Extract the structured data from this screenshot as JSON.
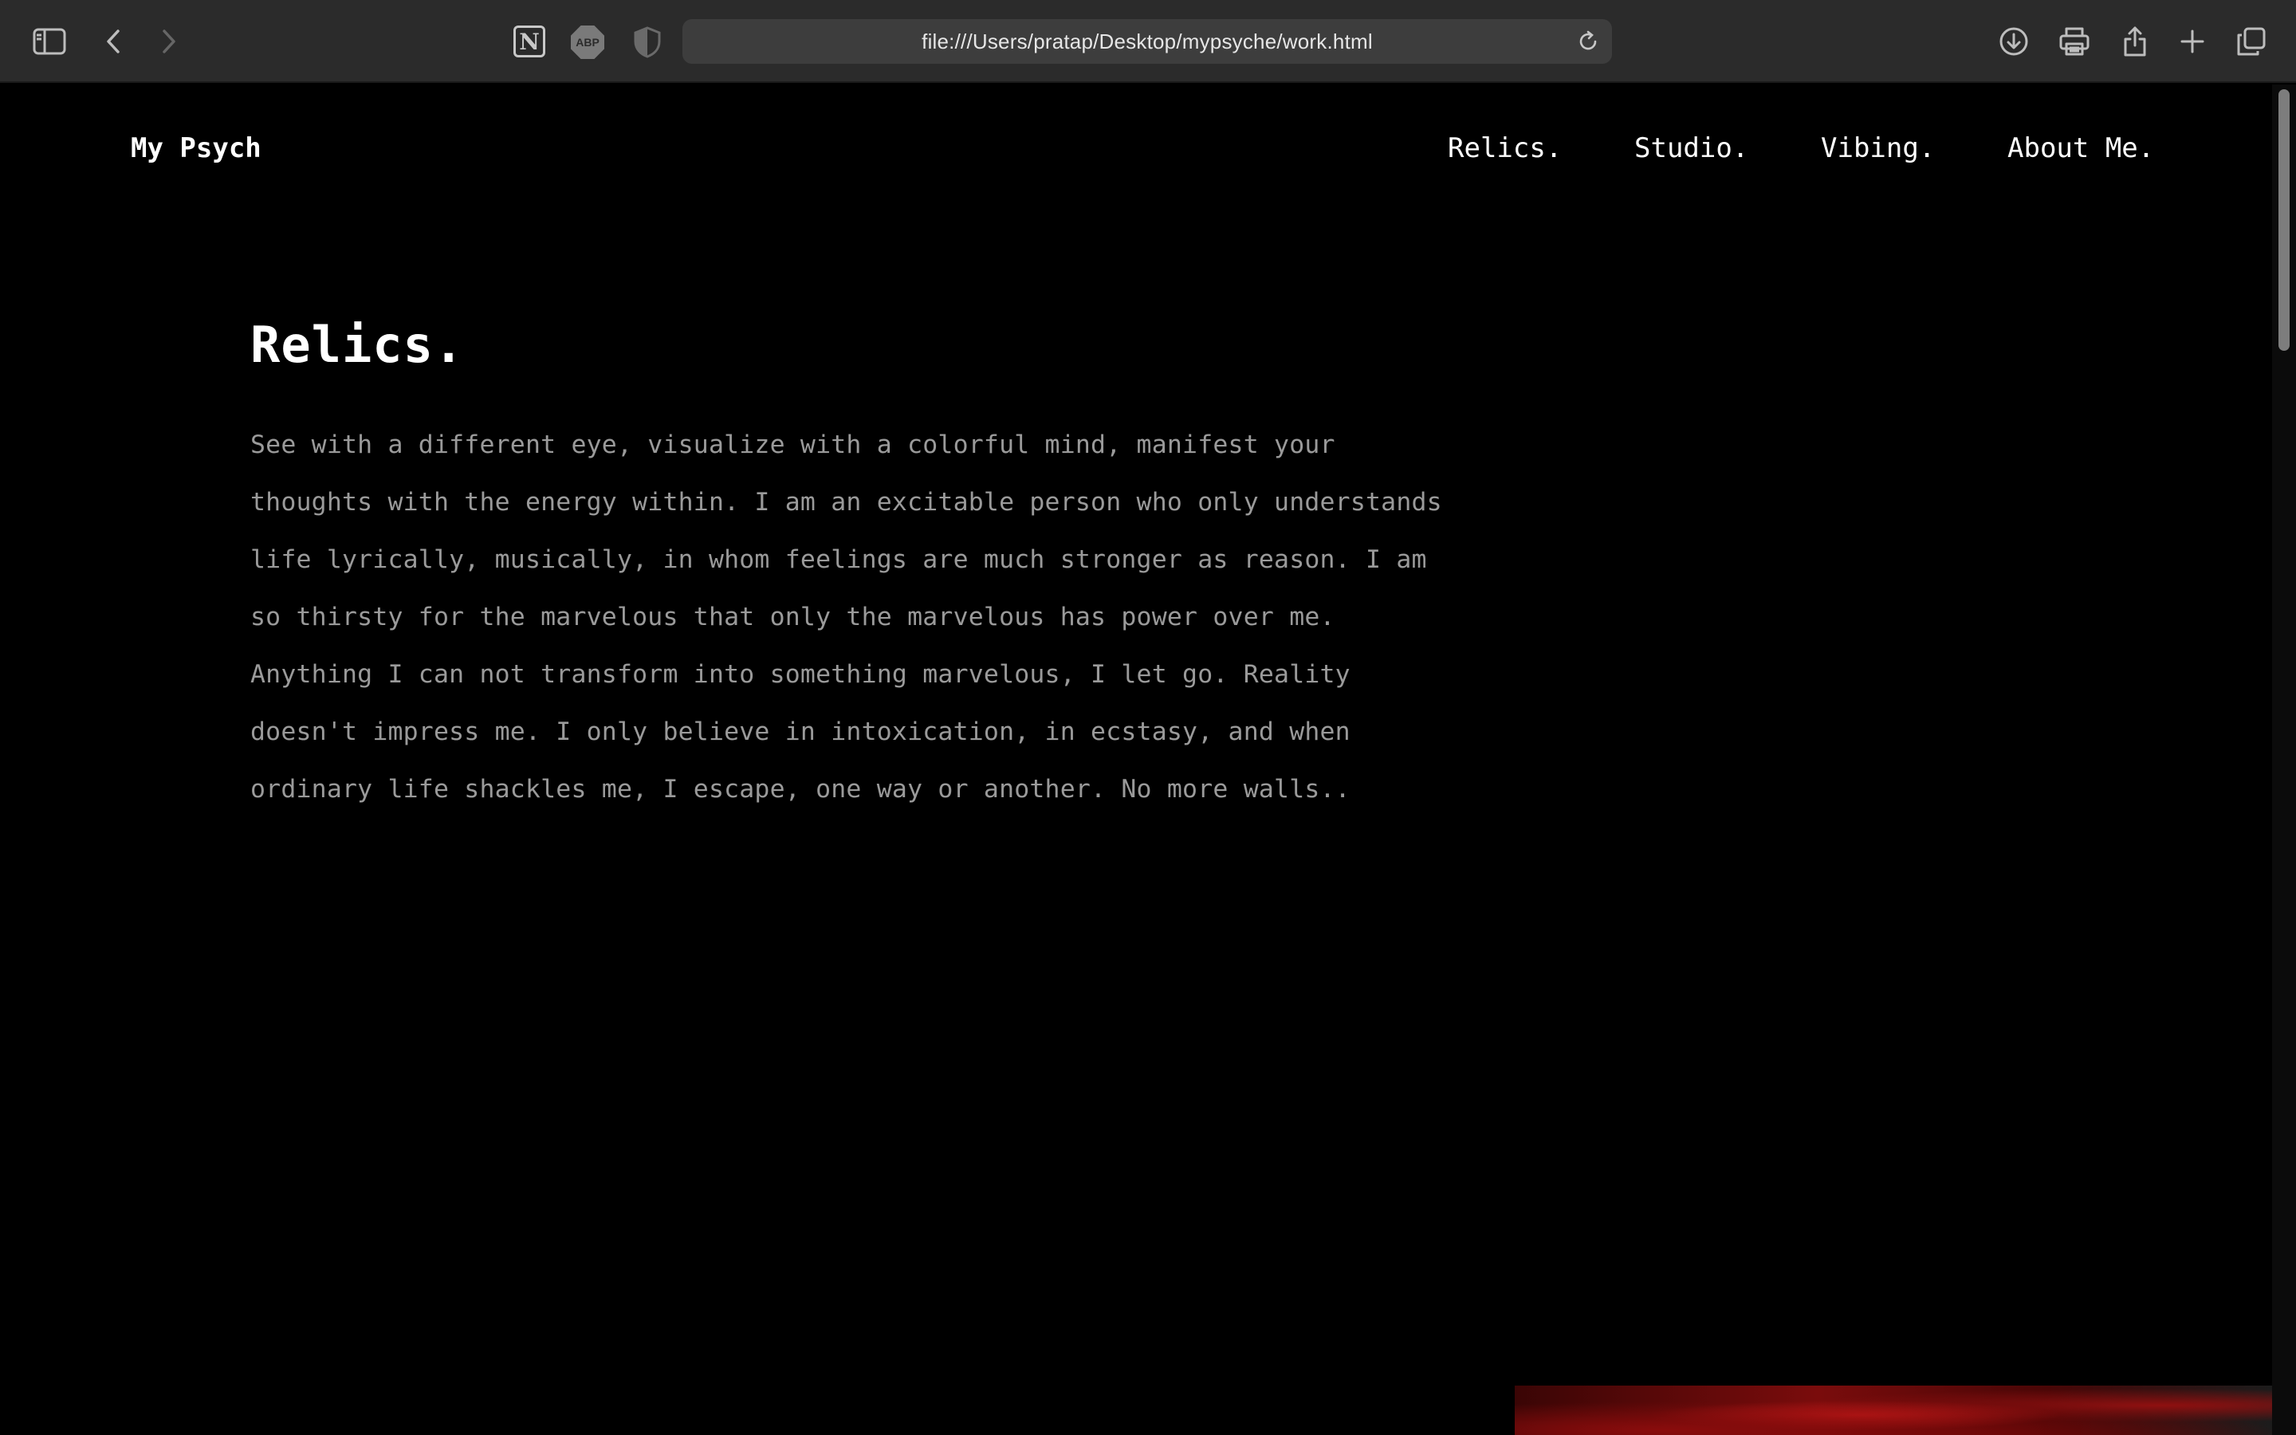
{
  "browser": {
    "url": "file:///Users/pratap/Desktop/mypsyche/work.html",
    "toolbar_icons": {
      "sidebar": "sidebar-icon",
      "back": "chevron-left-icon",
      "forward": "chevron-right-icon",
      "extensions": [
        "notion-icon",
        "adblock-plus-icon",
        "privacy-shield-icon"
      ],
      "reload": "reload-icon",
      "right": [
        "download-icon",
        "print-icon",
        "share-icon",
        "plus-icon",
        "tabs-overview-icon"
      ]
    },
    "extension_labels": {
      "notion": "N",
      "abp": "ABP"
    }
  },
  "site": {
    "brand": "My Psych",
    "nav": [
      {
        "label": "Relics."
      },
      {
        "label": "Studio."
      },
      {
        "label": "Vibing."
      },
      {
        "label": "About Me."
      }
    ]
  },
  "main": {
    "title": "Relics.",
    "body": "See with a different eye, visualize with a colorful mind, manifest your thoughts with the energy within. I am an excitable person who only understands life lyrically, musically, in whom feelings are much stronger as reason. I am so thirsty for the marvelous that only the marvelous has power over me. Anything I can not transform into something marvelous, I let go. Reality doesn't impress me. I only believe in intoxication, in ecstasy, and when ordinary life shackles me, I escape, one way or another. No more walls.."
  },
  "colors": {
    "page_background": "#000000",
    "text_primary": "#ffffff",
    "text_secondary": "#9a9a9a",
    "chrome_background": "#2b2b2b",
    "image_accent": "#b51616"
  }
}
